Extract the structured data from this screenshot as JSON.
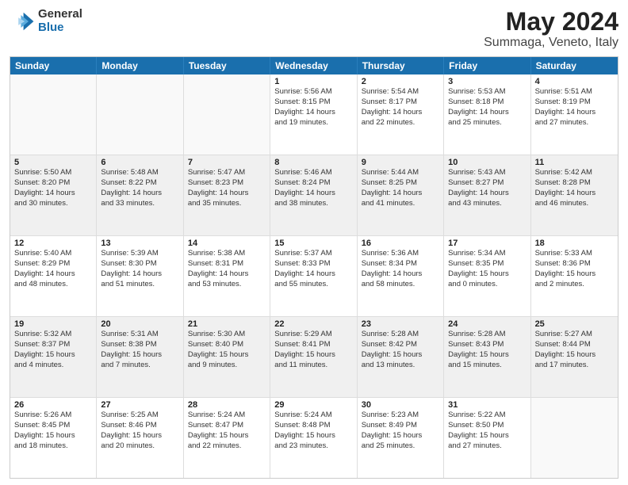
{
  "header": {
    "logo_general": "General",
    "logo_blue": "Blue",
    "title": "May 2024",
    "subtitle": "Summaga, Veneto, Italy"
  },
  "weekdays": [
    "Sunday",
    "Monday",
    "Tuesday",
    "Wednesday",
    "Thursday",
    "Friday",
    "Saturday"
  ],
  "rows": [
    [
      {
        "day": "",
        "lines": [],
        "empty": true
      },
      {
        "day": "",
        "lines": [],
        "empty": true
      },
      {
        "day": "",
        "lines": [],
        "empty": true
      },
      {
        "day": "1",
        "lines": [
          "Sunrise: 5:56 AM",
          "Sunset: 8:15 PM",
          "Daylight: 14 hours",
          "and 19 minutes."
        ]
      },
      {
        "day": "2",
        "lines": [
          "Sunrise: 5:54 AM",
          "Sunset: 8:17 PM",
          "Daylight: 14 hours",
          "and 22 minutes."
        ]
      },
      {
        "day": "3",
        "lines": [
          "Sunrise: 5:53 AM",
          "Sunset: 8:18 PM",
          "Daylight: 14 hours",
          "and 25 minutes."
        ]
      },
      {
        "day": "4",
        "lines": [
          "Sunrise: 5:51 AM",
          "Sunset: 8:19 PM",
          "Daylight: 14 hours",
          "and 27 minutes."
        ]
      }
    ],
    [
      {
        "day": "5",
        "lines": [
          "Sunrise: 5:50 AM",
          "Sunset: 8:20 PM",
          "Daylight: 14 hours",
          "and 30 minutes."
        ]
      },
      {
        "day": "6",
        "lines": [
          "Sunrise: 5:48 AM",
          "Sunset: 8:22 PM",
          "Daylight: 14 hours",
          "and 33 minutes."
        ]
      },
      {
        "day": "7",
        "lines": [
          "Sunrise: 5:47 AM",
          "Sunset: 8:23 PM",
          "Daylight: 14 hours",
          "and 35 minutes."
        ]
      },
      {
        "day": "8",
        "lines": [
          "Sunrise: 5:46 AM",
          "Sunset: 8:24 PM",
          "Daylight: 14 hours",
          "and 38 minutes."
        ]
      },
      {
        "day": "9",
        "lines": [
          "Sunrise: 5:44 AM",
          "Sunset: 8:25 PM",
          "Daylight: 14 hours",
          "and 41 minutes."
        ]
      },
      {
        "day": "10",
        "lines": [
          "Sunrise: 5:43 AM",
          "Sunset: 8:27 PM",
          "Daylight: 14 hours",
          "and 43 minutes."
        ]
      },
      {
        "day": "11",
        "lines": [
          "Sunrise: 5:42 AM",
          "Sunset: 8:28 PM",
          "Daylight: 14 hours",
          "and 46 minutes."
        ]
      }
    ],
    [
      {
        "day": "12",
        "lines": [
          "Sunrise: 5:40 AM",
          "Sunset: 8:29 PM",
          "Daylight: 14 hours",
          "and 48 minutes."
        ]
      },
      {
        "day": "13",
        "lines": [
          "Sunrise: 5:39 AM",
          "Sunset: 8:30 PM",
          "Daylight: 14 hours",
          "and 51 minutes."
        ]
      },
      {
        "day": "14",
        "lines": [
          "Sunrise: 5:38 AM",
          "Sunset: 8:31 PM",
          "Daylight: 14 hours",
          "and 53 minutes."
        ]
      },
      {
        "day": "15",
        "lines": [
          "Sunrise: 5:37 AM",
          "Sunset: 8:33 PM",
          "Daylight: 14 hours",
          "and 55 minutes."
        ]
      },
      {
        "day": "16",
        "lines": [
          "Sunrise: 5:36 AM",
          "Sunset: 8:34 PM",
          "Daylight: 14 hours",
          "and 58 minutes."
        ]
      },
      {
        "day": "17",
        "lines": [
          "Sunrise: 5:34 AM",
          "Sunset: 8:35 PM",
          "Daylight: 15 hours",
          "and 0 minutes."
        ]
      },
      {
        "day": "18",
        "lines": [
          "Sunrise: 5:33 AM",
          "Sunset: 8:36 PM",
          "Daylight: 15 hours",
          "and 2 minutes."
        ]
      }
    ],
    [
      {
        "day": "19",
        "lines": [
          "Sunrise: 5:32 AM",
          "Sunset: 8:37 PM",
          "Daylight: 15 hours",
          "and 4 minutes."
        ]
      },
      {
        "day": "20",
        "lines": [
          "Sunrise: 5:31 AM",
          "Sunset: 8:38 PM",
          "Daylight: 15 hours",
          "and 7 minutes."
        ]
      },
      {
        "day": "21",
        "lines": [
          "Sunrise: 5:30 AM",
          "Sunset: 8:40 PM",
          "Daylight: 15 hours",
          "and 9 minutes."
        ]
      },
      {
        "day": "22",
        "lines": [
          "Sunrise: 5:29 AM",
          "Sunset: 8:41 PM",
          "Daylight: 15 hours",
          "and 11 minutes."
        ]
      },
      {
        "day": "23",
        "lines": [
          "Sunrise: 5:28 AM",
          "Sunset: 8:42 PM",
          "Daylight: 15 hours",
          "and 13 minutes."
        ]
      },
      {
        "day": "24",
        "lines": [
          "Sunrise: 5:28 AM",
          "Sunset: 8:43 PM",
          "Daylight: 15 hours",
          "and 15 minutes."
        ]
      },
      {
        "day": "25",
        "lines": [
          "Sunrise: 5:27 AM",
          "Sunset: 8:44 PM",
          "Daylight: 15 hours",
          "and 17 minutes."
        ]
      }
    ],
    [
      {
        "day": "26",
        "lines": [
          "Sunrise: 5:26 AM",
          "Sunset: 8:45 PM",
          "Daylight: 15 hours",
          "and 18 minutes."
        ]
      },
      {
        "day": "27",
        "lines": [
          "Sunrise: 5:25 AM",
          "Sunset: 8:46 PM",
          "Daylight: 15 hours",
          "and 20 minutes."
        ]
      },
      {
        "day": "28",
        "lines": [
          "Sunrise: 5:24 AM",
          "Sunset: 8:47 PM",
          "Daylight: 15 hours",
          "and 22 minutes."
        ]
      },
      {
        "day": "29",
        "lines": [
          "Sunrise: 5:24 AM",
          "Sunset: 8:48 PM",
          "Daylight: 15 hours",
          "and 23 minutes."
        ]
      },
      {
        "day": "30",
        "lines": [
          "Sunrise: 5:23 AM",
          "Sunset: 8:49 PM",
          "Daylight: 15 hours",
          "and 25 minutes."
        ]
      },
      {
        "day": "31",
        "lines": [
          "Sunrise: 5:22 AM",
          "Sunset: 8:50 PM",
          "Daylight: 15 hours",
          "and 27 minutes."
        ]
      },
      {
        "day": "",
        "lines": [],
        "empty": true
      }
    ]
  ]
}
